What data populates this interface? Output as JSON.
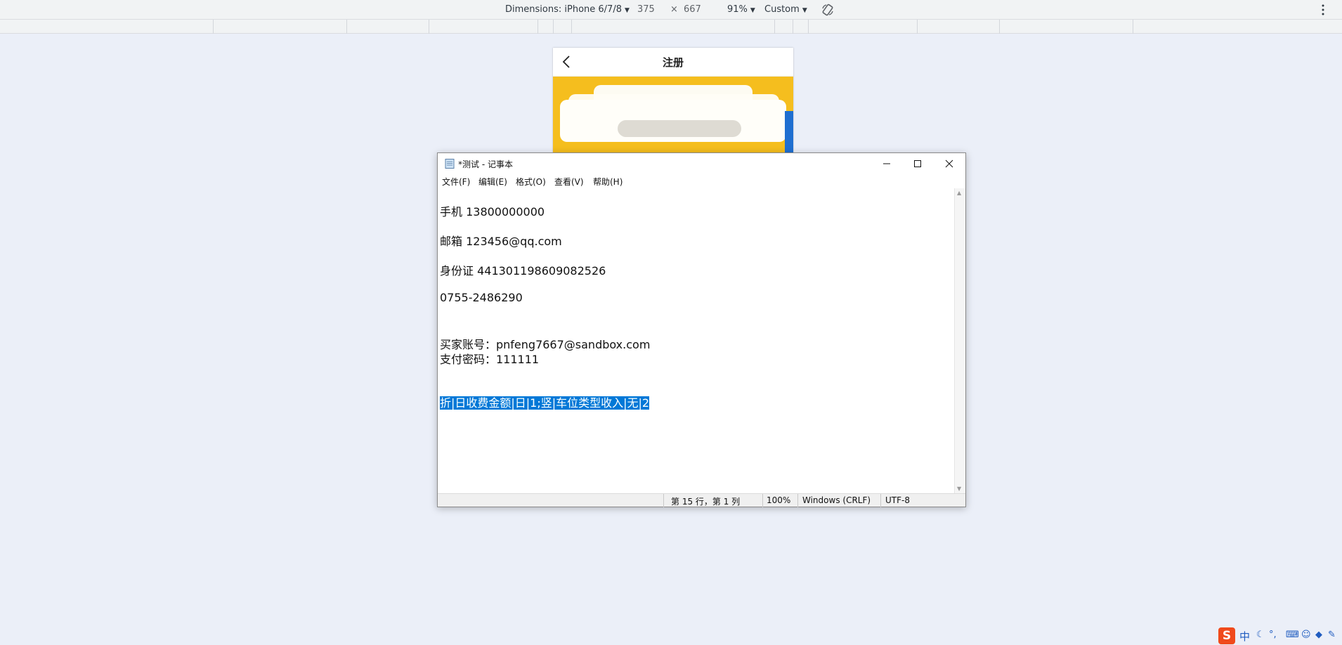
{
  "devtools": {
    "dimensions_label": "Dimensions: iPhone 6/7/8",
    "width": "375",
    "times": "×",
    "height": "667",
    "zoom": "91%",
    "throttle": "Custom"
  },
  "phone": {
    "title": "注册"
  },
  "notepad": {
    "title": "*测试 - 记事本",
    "menu": [
      "文件(F)",
      "编辑(E)",
      "格式(O)",
      "查看(V)",
      "帮助(H)"
    ],
    "lines": [
      "手机 13800000000",
      "邮箱 123456@qq.com",
      "身份证 441301198609082526",
      "0755-2486290",
      "买家账号：pnfeng7667@sandbox.com",
      "支付密码：111111"
    ],
    "selected_line": "折|日收费金额|日|1;竖|车位类型收入|无|2",
    "status": {
      "position": "第 15 行，第 1 列",
      "zoom": "100%",
      "line_ending": "Windows (CRLF)",
      "encoding": "UTF-8"
    }
  },
  "ime": {
    "logo": "S",
    "mode": "中"
  },
  "colors": {
    "selection": "#0078d7",
    "banner": "#f5be1e",
    "page_bg": "#ebeff8"
  }
}
